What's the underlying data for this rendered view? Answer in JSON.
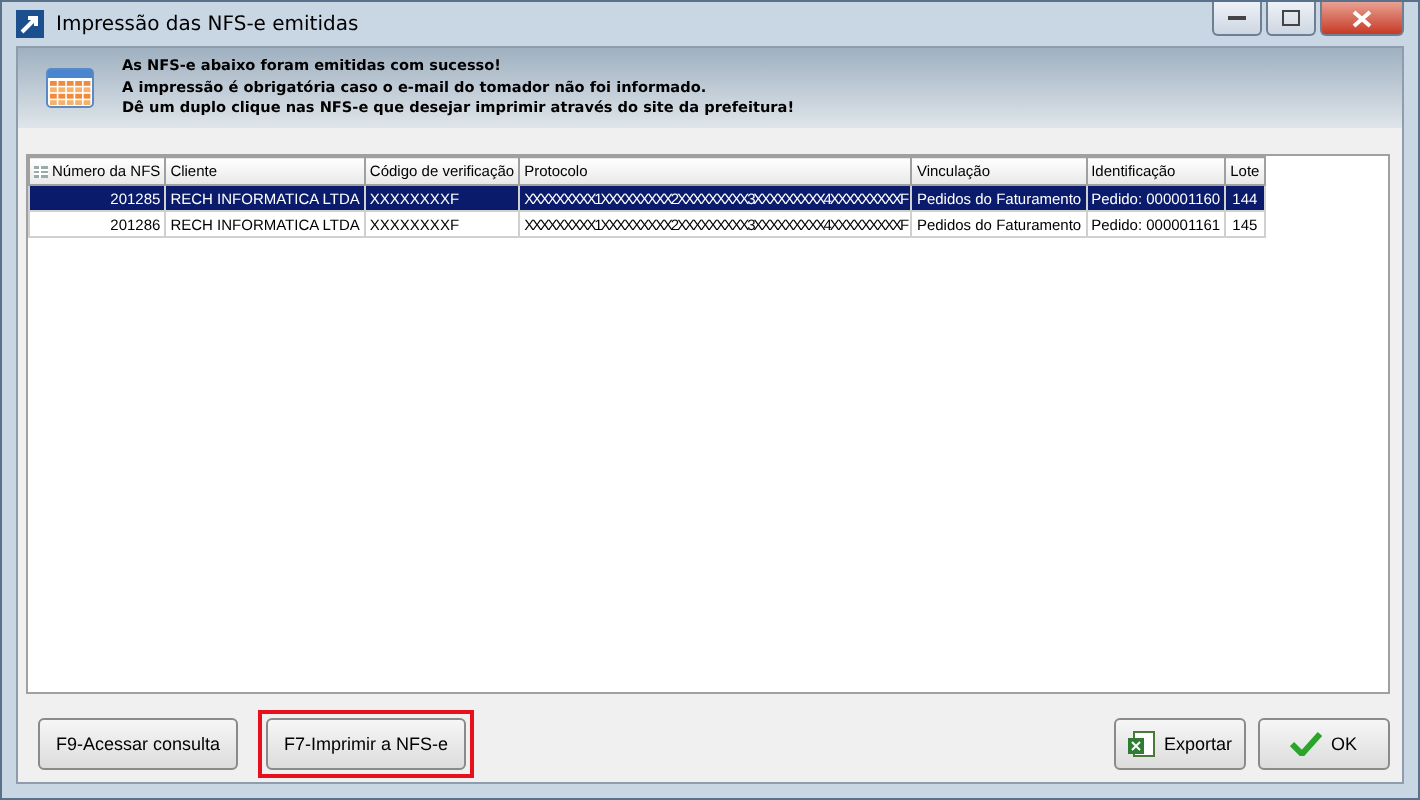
{
  "window": {
    "title": "Impressão das NFS-e emitidas"
  },
  "message": [
    "As NFS-e abaixo foram emitidas com sucesso!",
    "A impressão é obrigatória caso o e-mail do tomador não foi informado.",
    "Dê um duplo clique nas NFS-e que desejar imprimir através do site da prefeitura!"
  ],
  "table": {
    "columns": [
      "Número da NFS",
      "Cliente",
      "Código de verificação",
      "Protocolo",
      "Vinculação",
      "Identificação",
      "Lote"
    ],
    "rows": [
      {
        "selected": true,
        "cells": [
          "201285",
          "RECH INFORMATICA LTDA",
          "XXXXXXXXF",
          "XXXXXXXXX1XXXXXXXXX2XXXXXXXXX3XXXXXXXXX4XXXXXXXXXF",
          "Pedidos do Faturamento",
          "Pedido: 000001160",
          "144"
        ]
      },
      {
        "selected": false,
        "cells": [
          "201286",
          "RECH INFORMATICA LTDA",
          "XXXXXXXXF",
          "XXXXXXXXX1XXXXXXXXX2XXXXXXXXX3XXXXXXXXX4XXXXXXXXXF",
          "Pedidos do Faturamento",
          "Pedido: 000001161",
          "145"
        ]
      }
    ]
  },
  "buttons_left": [
    {
      "label": "F9-Acessar consulta",
      "highlighted": false
    },
    {
      "label": "F7-Imprimir a NFS-e",
      "highlighted": true
    }
  ],
  "buttons_right": [
    {
      "label": "Exportar",
      "kind": "export"
    },
    {
      "label": "OK",
      "kind": "ok"
    }
  ]
}
